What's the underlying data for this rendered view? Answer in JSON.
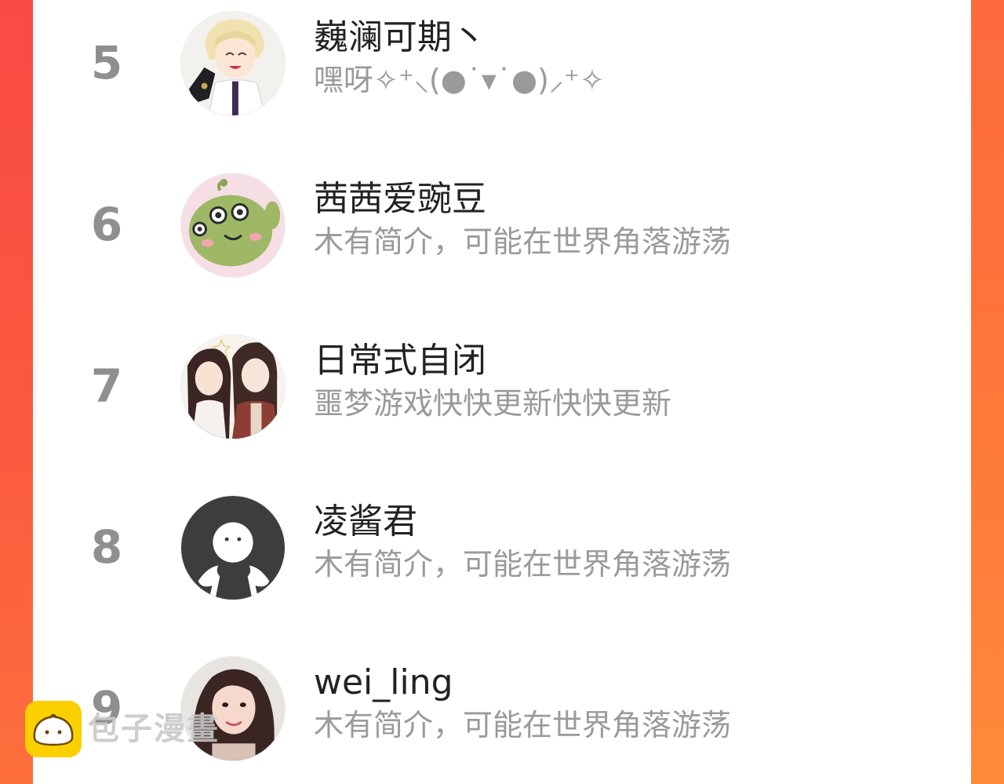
{
  "ranking": {
    "entries": [
      {
        "rank": "5",
        "name": "巍澜可期丶",
        "bio": "嘿呀✧⁺⸜(●˙▾˙●)⸝⁺✧",
        "avatar": "anime-blonde-character-avatar"
      },
      {
        "rank": "6",
        "name": "茜茜爱豌豆",
        "bio": "木有简介，可能在世界角落游荡",
        "avatar": "green-alien-avatar"
      },
      {
        "rank": "7",
        "name": "日常式自闭",
        "bio": "噩梦游戏快快更新快快更新",
        "avatar": "anime-couple-avatar"
      },
      {
        "rank": "8",
        "name": "凌酱君",
        "bio": "木有简介，可能在世界角落游荡",
        "avatar": "default-user-avatar"
      },
      {
        "rank": "9",
        "name": "wei_ling",
        "bio": "木有简介，可能在世界角落游荡",
        "avatar": "girl-photo-avatar"
      }
    ]
  },
  "watermark": {
    "text": "包子漫畫",
    "logo": "bun-logo-icon"
  },
  "colors": {
    "background_left": "#fa4a45",
    "background_right": "#ff8a3a",
    "card": "#ffffff",
    "rank_text": "#8f8f8f",
    "name_text": "#222222",
    "bio_text": "#9a9a9a"
  }
}
